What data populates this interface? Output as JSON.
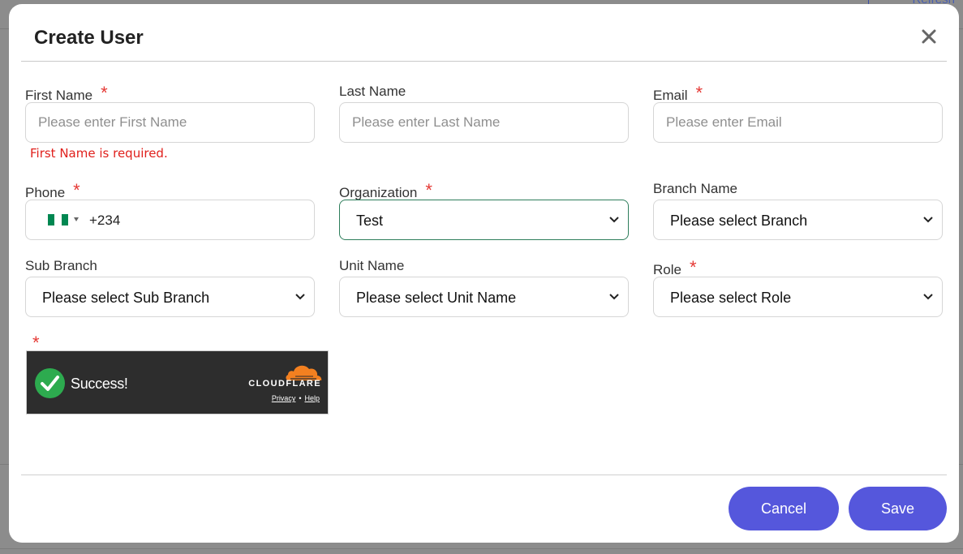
{
  "background": {
    "corner_text": "Refresh"
  },
  "modal": {
    "title": "Create User",
    "close_icon": "close-icon"
  },
  "form": {
    "first_name": {
      "label": "First Name",
      "required": "*",
      "placeholder": "Please enter First Name",
      "value": "",
      "error": "First Name is required."
    },
    "last_name": {
      "label": "Last Name",
      "placeholder": "Please enter Last Name",
      "value": ""
    },
    "email": {
      "label": "Email",
      "required": "*",
      "placeholder": "Please enter Email",
      "value": ""
    },
    "phone": {
      "label": "Phone",
      "required": "*",
      "country_flag": "nigeria-flag-icon",
      "dial_code": "+234"
    },
    "organization": {
      "label": "Organization",
      "required": "*",
      "selected": "Test"
    },
    "branch_name": {
      "label": "Branch Name",
      "selected": "Please select Branch"
    },
    "sub_branch": {
      "label": "Sub Branch",
      "selected": "Please select Sub Branch"
    },
    "unit_name": {
      "label": "Unit Name",
      "selected": "Please select Unit Name"
    },
    "role": {
      "label": "Role",
      "required": "*",
      "selected": "Please select Role"
    },
    "captcha": {
      "required": "*",
      "status": "Success!",
      "brand": "CLOUDFLARE",
      "privacy_link": "Privacy",
      "separator": "•",
      "help_link": "Help"
    }
  },
  "footer": {
    "cancel_label": "Cancel",
    "save_label": "Save"
  },
  "colors": {
    "primary_button": "#5557dc",
    "required_star": "#e53935",
    "error_text": "#e0201c",
    "focus_border": "#2e7d5b",
    "captcha_success": "#2dab4f",
    "cloudflare_orange": "#f38020"
  }
}
